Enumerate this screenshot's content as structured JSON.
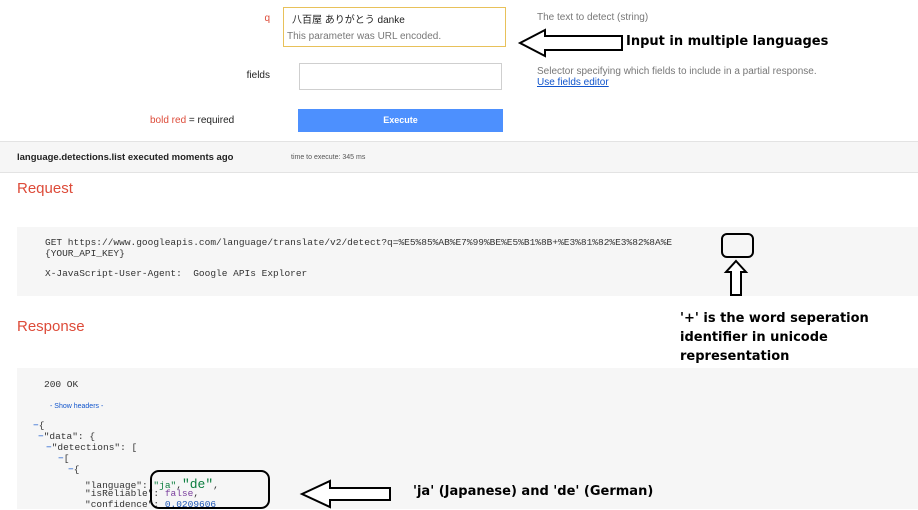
{
  "form": {
    "q_label": "q",
    "q_value": "八百屋 ありがとう danke",
    "q_note": "This parameter was URL encoded.",
    "q_desc": "The text to detect (string)",
    "fields_label": "fields",
    "fields_value": "",
    "fields_desc": "Selector specifying which fields to include in a partial response.",
    "fields_link": "Use fields editor",
    "legend_bold": "bold red",
    "legend_rest": " = required",
    "execute_label": "Execute"
  },
  "status": {
    "executed": "language.detections.list executed moments ago",
    "time": "time to execute: 345 ms"
  },
  "request": {
    "title": "Request",
    "line1": "GET https://www.googleapis.com/language/translate/v2/detect?q=%E5%85%AB%E7%99%BE%E5%B1%8B+%E3%81%82%E3%82%8A%E",
    "line2": "{YOUR_API_KEY}",
    "header_key": "X-JavaScript-User-Agent:",
    "header_val": "Google APIs Explorer"
  },
  "response": {
    "title": "Response",
    "status": "200 OK",
    "show_headers": "- Show headers -",
    "json": {
      "open": "{",
      "data_key": "\"data\"",
      "detections_key": "\"detections\"",
      "arr": "[",
      "obj": "{",
      "language_key": "\"language\"",
      "language_val": "\"ja\"",
      "language_val2": "\"de\"",
      "reliable_key": "\"isReliable\"",
      "reliable_val": "false",
      "confidence_key": "\"confidence\"",
      "confidence_val": "0.0209606"
    }
  },
  "annotations": {
    "input_note": "Input in multiple languages",
    "plus_note_1": "'+' is the word seperation",
    "plus_note_2": "identifier in unicode",
    "plus_note_3": "representation",
    "lang_note": "'ja' (Japanese) and 'de' (German)"
  },
  "colors": {
    "required": "#dd4b39",
    "execute": "#4d90fe",
    "panel": "#f6f6f6"
  }
}
